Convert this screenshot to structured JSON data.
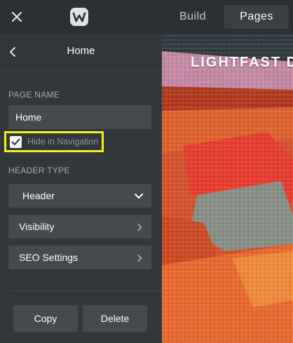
{
  "topbar": {
    "close_icon": "close-icon",
    "logo_icon": "weebly-logo-icon",
    "tabs": [
      {
        "label": "Build",
        "active": false
      },
      {
        "label": "Pages",
        "active": true
      }
    ]
  },
  "panel": {
    "back_icon": "chevron-left-icon",
    "title": "Home",
    "page_name_label": "PAGE NAME",
    "page_name_value": "Home",
    "hide_in_navigation": {
      "label": "Hide in Navigation",
      "checked": true
    },
    "header_type_label": "HEADER TYPE",
    "header_select": "Header",
    "rows": [
      {
        "label": "Visibility",
        "icon": "chevron-right-icon"
      },
      {
        "label": "SEO Settings",
        "icon": "chevron-right-icon"
      }
    ],
    "copy_label": "Copy",
    "delete_label": "Delete"
  },
  "preview": {
    "site_title": "LIGHTFAST D"
  },
  "colors": {
    "topbar": "#2d3033",
    "panel": "#33373b",
    "control": "#46494d",
    "highlight": "#f5f01a"
  }
}
